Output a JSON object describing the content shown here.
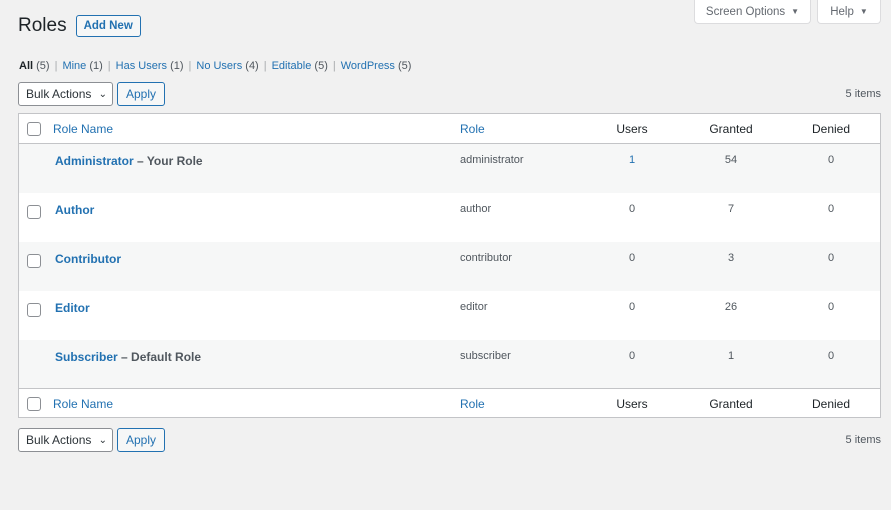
{
  "screen_meta": {
    "screen_options_label": "Screen Options",
    "help_label": "Help"
  },
  "page": {
    "title": "Roles",
    "add_new_label": "Add New"
  },
  "views": [
    {
      "label": "All",
      "count": "(5)"
    },
    {
      "label": "Mine",
      "count": "(1)"
    },
    {
      "label": "Has Users",
      "count": "(1)"
    },
    {
      "label": "No Users",
      "count": "(4)"
    },
    {
      "label": "Editable",
      "count": "(5)"
    },
    {
      "label": "WordPress",
      "count": "(5)"
    }
  ],
  "tablenav": {
    "bulk_actions": "Bulk Actions",
    "apply_label": "Apply",
    "items_count": "5 items"
  },
  "table": {
    "columns": {
      "role_name": "Role Name",
      "role": "Role",
      "users": "Users",
      "granted": "Granted",
      "denied": "Denied"
    },
    "rows": [
      {
        "name": "Administrator",
        "state": " – Your Role",
        "role": "administrator",
        "users": "1",
        "granted": "54",
        "denied": "0"
      },
      {
        "name": "Author",
        "state": "",
        "role": "author",
        "users": "0",
        "granted": "7",
        "denied": "0"
      },
      {
        "name": "Contributor",
        "state": "",
        "role": "contributor",
        "users": "0",
        "granted": "3",
        "denied": "0"
      },
      {
        "name": "Editor",
        "state": "",
        "role": "editor",
        "users": "0",
        "granted": "26",
        "denied": "0"
      },
      {
        "name": "Subscriber",
        "state": " – Default Role",
        "role": "subscriber",
        "users": "0",
        "granted": "1",
        "denied": "0"
      }
    ]
  }
}
